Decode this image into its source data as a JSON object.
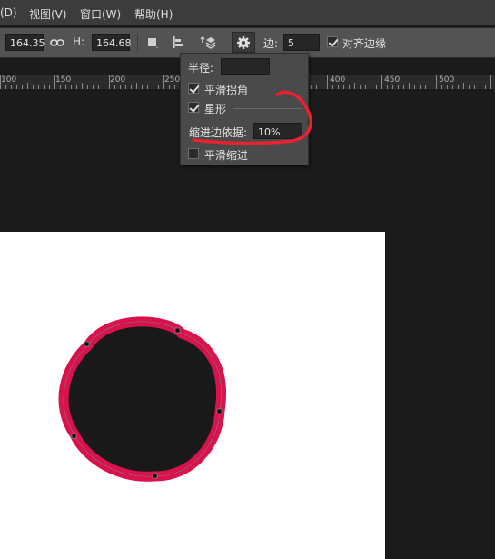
{
  "menu": {
    "items": [
      "(D)",
      "视图(V)",
      "窗口(W)",
      "帮助(H)"
    ]
  },
  "toolbar": {
    "width_value": "164.35",
    "height_label": "H:",
    "height_value": "164.68",
    "sides_label": "边:",
    "sides_value": "5",
    "align_edges_label": "对齐边缘",
    "align_edges_checked": true
  },
  "ruler": {
    "ticks": [
      "100",
      "150",
      "200",
      "250",
      "400",
      "450",
      "500"
    ]
  },
  "popup": {
    "radius_label": "半径:",
    "radius_value": "",
    "smooth_corners_label": "平滑拐角",
    "smooth_corners_checked": true,
    "star_label": "星形",
    "star_checked": true,
    "indent_label": "缩进边依据:",
    "indent_value": "10%",
    "smooth_indents_label": "平滑缩进",
    "smooth_indents_checked": false
  },
  "colors": {
    "shape_fill": "#19191a",
    "shape_stroke": "#d9124c",
    "annotation": "#e8232f"
  },
  "icons": [
    "link-icon",
    "path-operations-icon",
    "path-alignment-icon",
    "path-arrangement-icon",
    "gear-icon"
  ]
}
